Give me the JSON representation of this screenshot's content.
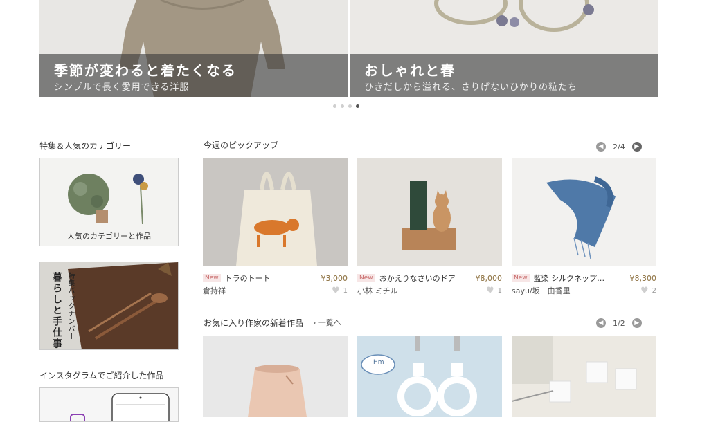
{
  "hero": {
    "slides": [
      {
        "title": "季節が変わると着たくなる",
        "subtitle": "シンプルで長く愛用できる洋服"
      },
      {
        "title": "おしゃれと春",
        "subtitle": "ひきだしから溢れる、さりげないひかりの粒たち"
      }
    ]
  },
  "sidebar": {
    "heading1": "特集＆人気のカテゴリー",
    "card1_label": "人気のカテゴリーと作品",
    "card2_text_small": "特集バックナンバー",
    "card2_text_large": "暮らしと手仕事",
    "heading2": "インスタグラムでご紹介した作品"
  },
  "pickup": {
    "title": "今週のピックアップ",
    "pager": "2/4",
    "items": [
      {
        "badge": "New",
        "name": "トラのトート",
        "price": "¥3,000",
        "maker": "倉持祥",
        "likes": "1"
      },
      {
        "badge": "New",
        "name": "おかえりなさいのドア",
        "price": "¥8,000",
        "maker": "小林 ミチル",
        "likes": "1"
      },
      {
        "badge": "New",
        "name": "藍染 シルクネップ…",
        "price": "¥8,300",
        "maker": "sayu/坂　由香里",
        "likes": "2"
      }
    ]
  },
  "favorites": {
    "title": "お気に入り作家の新着作品",
    "more": "一覧へ",
    "pager": "1/2",
    "tag_text": "Hm"
  }
}
